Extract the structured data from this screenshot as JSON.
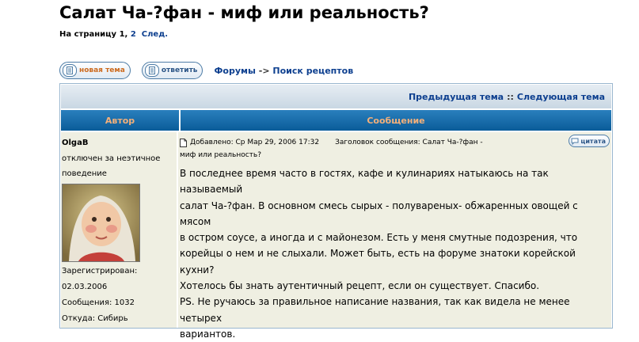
{
  "topic": {
    "title": "Салат Ча-?фан - миф или реальность?"
  },
  "pagination": {
    "prefix": "На страницу",
    "pages": [
      "1",
      "2"
    ],
    "current": "1",
    "next_label": "След."
  },
  "toolbar": {
    "new_topic_label": "новая тема",
    "reply_label": "ответить",
    "breadcrumb_forums": "Форумы",
    "breadcrumb_sep": "->",
    "breadcrumb_section": "Поиск рецептов"
  },
  "topic_nav": {
    "prev": "Предыдущая тема",
    "sep": "::",
    "next": "Следующая тема"
  },
  "table_headers": {
    "author": "Автор",
    "message": "Сообщение"
  },
  "post": {
    "author": "OlgaB",
    "rank_line1": "отключен за неэтичное",
    "rank_line2": "поведение",
    "registered_label": "Зарегистрирован:",
    "registered_date": "02.03.2006",
    "messages_label": "Сообщения: 1032",
    "from_label": "Откуда: Сибирь",
    "added_label": "Добавлено: Ср Мар 29, 2006 17:32",
    "subject_label": "Заголовок сообщения: Салат Ча-?фан -",
    "subject_cont": "миф или реальность?",
    "quote_label": "цитата",
    "body_lines": [
      "В последнее время часто в гостях, кафе и кулинариях натыкаюсь на так называемый",
      "салат Ча-?фан. В основном смесь сырых - полувареных- обжаренных овощей с мясом",
      "в остром соусе, а иногда и с майонезом. Есть у меня смутные подозрения, что",
      "корейцы о нем и не слыхали. Может быть, есть на форуме знатоки корейской кухни?",
      "Хотелось бы знать аутентичный рецепт, если он существует. Спасибо.",
      "PS. Не ручаюсь за правильное написание названия, так как видела не менее четырех",
      "вариантов."
    ]
  },
  "colors": {
    "link": "#0d3f8f",
    "header_bg": "#0a5c99",
    "header_text": "#f4b07a",
    "cell_bg": "#efefe2"
  }
}
